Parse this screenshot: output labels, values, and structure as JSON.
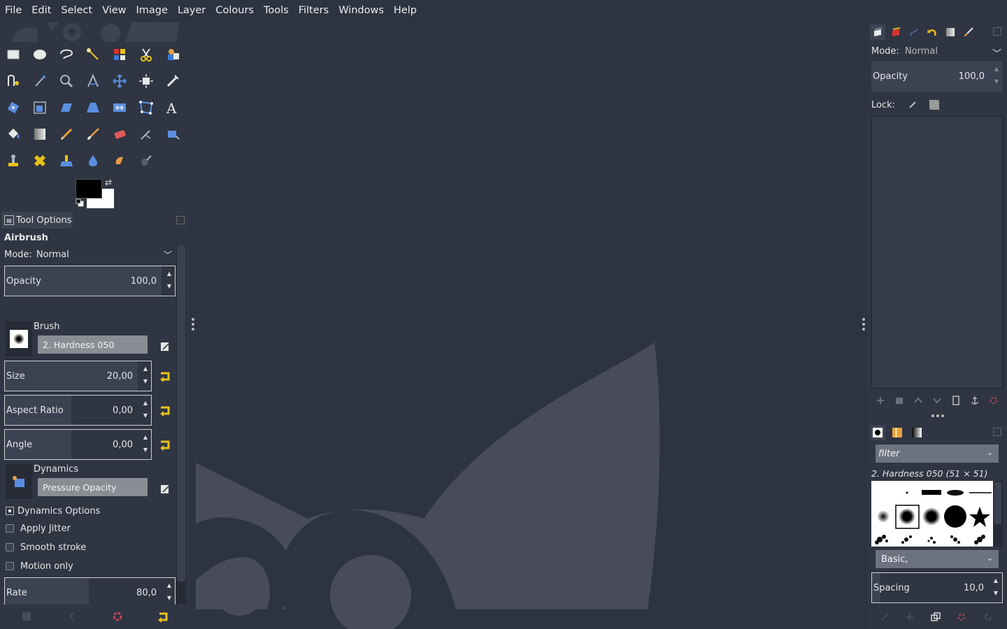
{
  "menubar": {
    "items": [
      "File",
      "Edit",
      "Select",
      "View",
      "Image",
      "Layer",
      "Colours",
      "Tools",
      "Filters",
      "Windows",
      "Help"
    ]
  },
  "toolbox": {
    "rows": [
      [
        "rect-select-icon",
        "ellipse-select-icon",
        "free-select-icon",
        "fuzzy-select-icon",
        "select-by-color-icon",
        "scissors-select-icon",
        "foreground-select-icon"
      ],
      [
        "paths-icon",
        "color-picker-icon",
        "zoom-icon",
        "measure-icon",
        "move-icon",
        "align-icon",
        "crop-icon"
      ],
      [
        "rotate-icon",
        "scale-icon",
        "shear-icon",
        "perspective-icon",
        "flip-icon",
        "cage-icon",
        "text-icon"
      ],
      [
        "bucket-fill-icon",
        "gradient-icon",
        "pencil-icon",
        "paintbrush-icon",
        "eraser-icon",
        "airbrush-icon",
        "ink-icon"
      ],
      [
        "clone-icon",
        "heal-icon",
        "perspective-clone-icon",
        "blur-icon",
        "smudge-icon",
        "dodge-burn-icon"
      ]
    ],
    "colors": {
      "fg": "#000000",
      "bg": "#ffffff"
    }
  },
  "tool_options": {
    "tab_label": "Tool Options",
    "tool_name": "Airbrush",
    "mode_label": "Mode:",
    "mode_value": "Normal",
    "opacity": {
      "label": "Opacity",
      "value": "100,0"
    },
    "brush": {
      "label": "Brush",
      "value": "2. Hardness 050"
    },
    "size": {
      "label": "Size",
      "value": "20,00"
    },
    "aspect_ratio": {
      "label": "Aspect Ratio",
      "value": "0,00"
    },
    "angle": {
      "label": "Angle",
      "value": "0,00"
    },
    "dynamics": {
      "label": "Dynamics",
      "value": "Pressure Opacity"
    },
    "dynamics_options": "Dynamics Options",
    "apply_jitter": "Apply Jitter",
    "smooth_stroke": "Smooth stroke",
    "motion_only": "Motion only",
    "rate": {
      "label": "Rate",
      "value": "80,0"
    }
  },
  "layers": {
    "mode_label": "Mode:",
    "mode_value": "Normal",
    "opacity_label": "Opacity",
    "opacity_value": "100,0",
    "lock_label": "Lock:"
  },
  "brushes": {
    "filter_placeholder": "filter",
    "selected_name": "2. Hardness 050 (51 × 51)",
    "tag_value": "Basic,",
    "spacing_label": "Spacing",
    "spacing_value": "10,0"
  },
  "colors": {
    "background": "#2d3340",
    "dock": "#2f3542",
    "accent_yellow": "#e8c21a",
    "wilber": "#474c58"
  }
}
